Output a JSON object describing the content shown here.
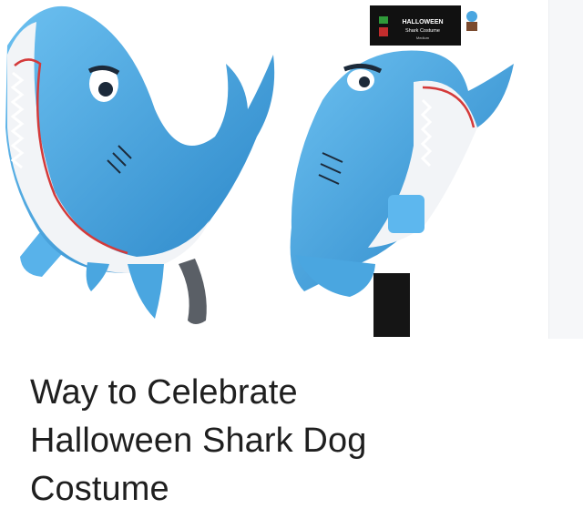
{
  "images": [
    {
      "alt": "Blue shark dog costume, side view",
      "icon": "shark-costume-image"
    },
    {
      "alt": "Blue shark dog costume with packaging tag",
      "icon": "shark-costume-packaged-image",
      "tag": {
        "title": "HALLOWEEN",
        "subtitle": "Shark Costume",
        "fine_print": "Medium",
        "size_badge": "medium"
      }
    },
    {
      "alt": "Next image",
      "icon": "next-image"
    }
  ],
  "result": {
    "title_lines": [
      "Way to Celebrate",
      "Halloween Shark Dog",
      "Costume"
    ]
  },
  "colors": {
    "shark_blue": "#4aa6e0",
    "shark_dark": "#2a86c8",
    "belly": "#f2f4f7",
    "title_text": "#1f1f1f"
  }
}
